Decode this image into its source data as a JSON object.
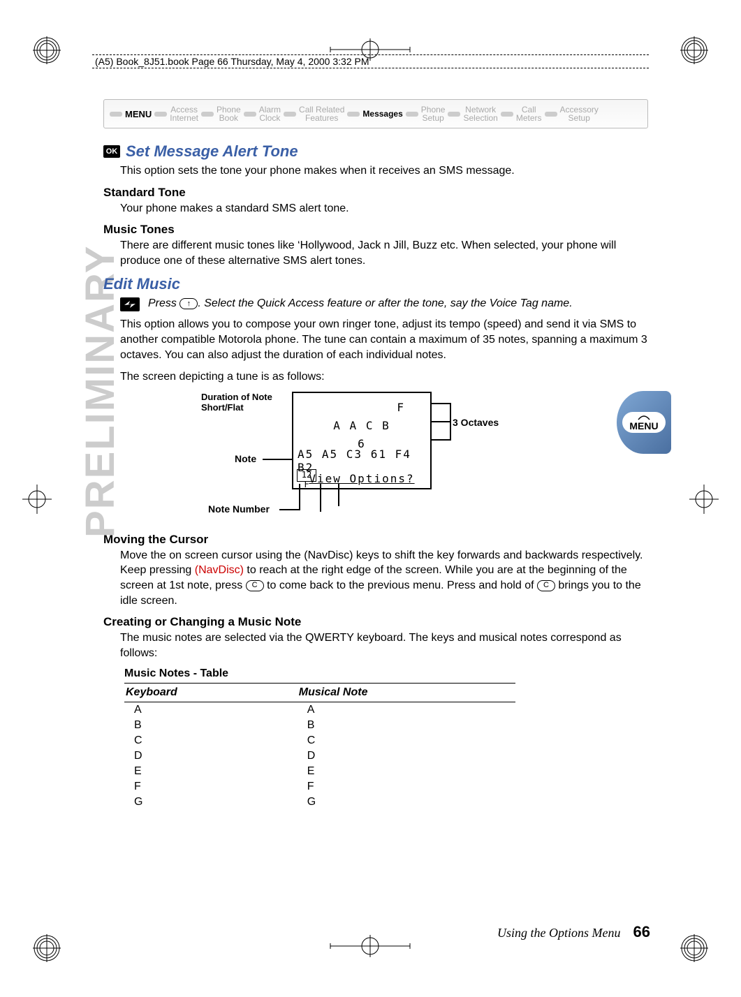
{
  "header_line": "(A5) Book_8J51.book  Page 66  Thursday, May 4, 2000  3:32 PM",
  "menu_bar": {
    "menu_label": "MENU",
    "items": [
      {
        "top": "Access",
        "bottom": "Internet"
      },
      {
        "top": "Phone",
        "bottom": "Book"
      },
      {
        "top": "Alarm",
        "bottom": "Clock"
      },
      {
        "top": "Call Related",
        "bottom": "Features"
      },
      {
        "top": "Messages",
        "bottom": "",
        "active": true
      },
      {
        "top": "Phone",
        "bottom": "Setup"
      },
      {
        "top": "Network",
        "bottom": "Selection"
      },
      {
        "top": "Call",
        "bottom": "Meters"
      },
      {
        "top": "Accessory",
        "bottom": "Setup"
      }
    ]
  },
  "preliminary": "PRELIMINARY",
  "ok_icon_label": "OK",
  "h_set_message": "Set Message Alert Tone",
  "p_set_message": "This option sets the tone your phone makes when it receives an SMS message.",
  "h_std_tone": "Standard Tone",
  "p_std_tone": "Your phone makes a standard SMS alert tone.",
  "h_music_tones": "Music Tones",
  "p_music_tones": "There are different music tones like ‘Hollywood, Jack n Jill, Buzz etc. When selected, your phone will produce one of these alternative SMS alert tones.",
  "h_edit_music": "Edit Music",
  "note1_pre": "Press ",
  "note1_post": ". Select the Quick Access feature or after the tone, say the Voice Tag name.",
  "key_up": "↑",
  "p_edit1": "This option allows you to compose your own ringer tone, adjust its tempo (speed) and send it via SMS to another compatible Motorola phone. The tune can contain a maximum of 35 notes, spanning a maximum 3 octaves. You can also adjust the duration of each individual notes.",
  "p_edit2": "The screen depicting a tune is as follows:",
  "figure": {
    "row_f": "F",
    "row_aacb": "A   A   C            B",
    "row_6": "6",
    "row_notes": "A5  A5  C3  61  F4  B2",
    "row_num": "12 F",
    "row_view": "View Options?",
    "lbl_note": "Note",
    "lbl_notenum": "Note Number",
    "lbl_octaves": "3 Octaves",
    "lbl_duration": "Duration of Note",
    "lbl_shortflat": "Short/Flat"
  },
  "h_moving": "Moving the Cursor",
  "p_moving_1": "Move the on screen cursor using the ",
  "p_moving_navdisc1": "(NavDisc)",
  "p_moving_2": " keys to shift the key forwards and backwards respectively. Keep pressing ",
  "p_moving_navdisc2": "(NavDisc)",
  "p_moving_3": " to reach at the right edge of the screen. While you are at the beginning of the screen at 1st note, press ",
  "key_c": "C",
  "p_moving_4": " to come back to the previous menu. Press and hold of ",
  "p_moving_5": " brings you to the idle screen.",
  "h_creating": "Creating or Changing a Music Note",
  "p_creating": "The music notes are selected via the QWERTY keyboard. The keys and musical notes correspond as follows:",
  "menu_button_label": "MENU",
  "table": {
    "caption": "Music Notes - Table",
    "col1": "Keyboard",
    "col2": "Musical Note",
    "rows": [
      {
        "k": "A",
        "n": "A"
      },
      {
        "k": "B",
        "n": "B"
      },
      {
        "k": "C",
        "n": "C"
      },
      {
        "k": "D",
        "n": "D"
      },
      {
        "k": "E",
        "n": "E"
      },
      {
        "k": "F",
        "n": "F"
      },
      {
        "k": "G",
        "n": "G"
      }
    ]
  },
  "footer": {
    "text": "Using the Options Menu",
    "page": "66"
  }
}
